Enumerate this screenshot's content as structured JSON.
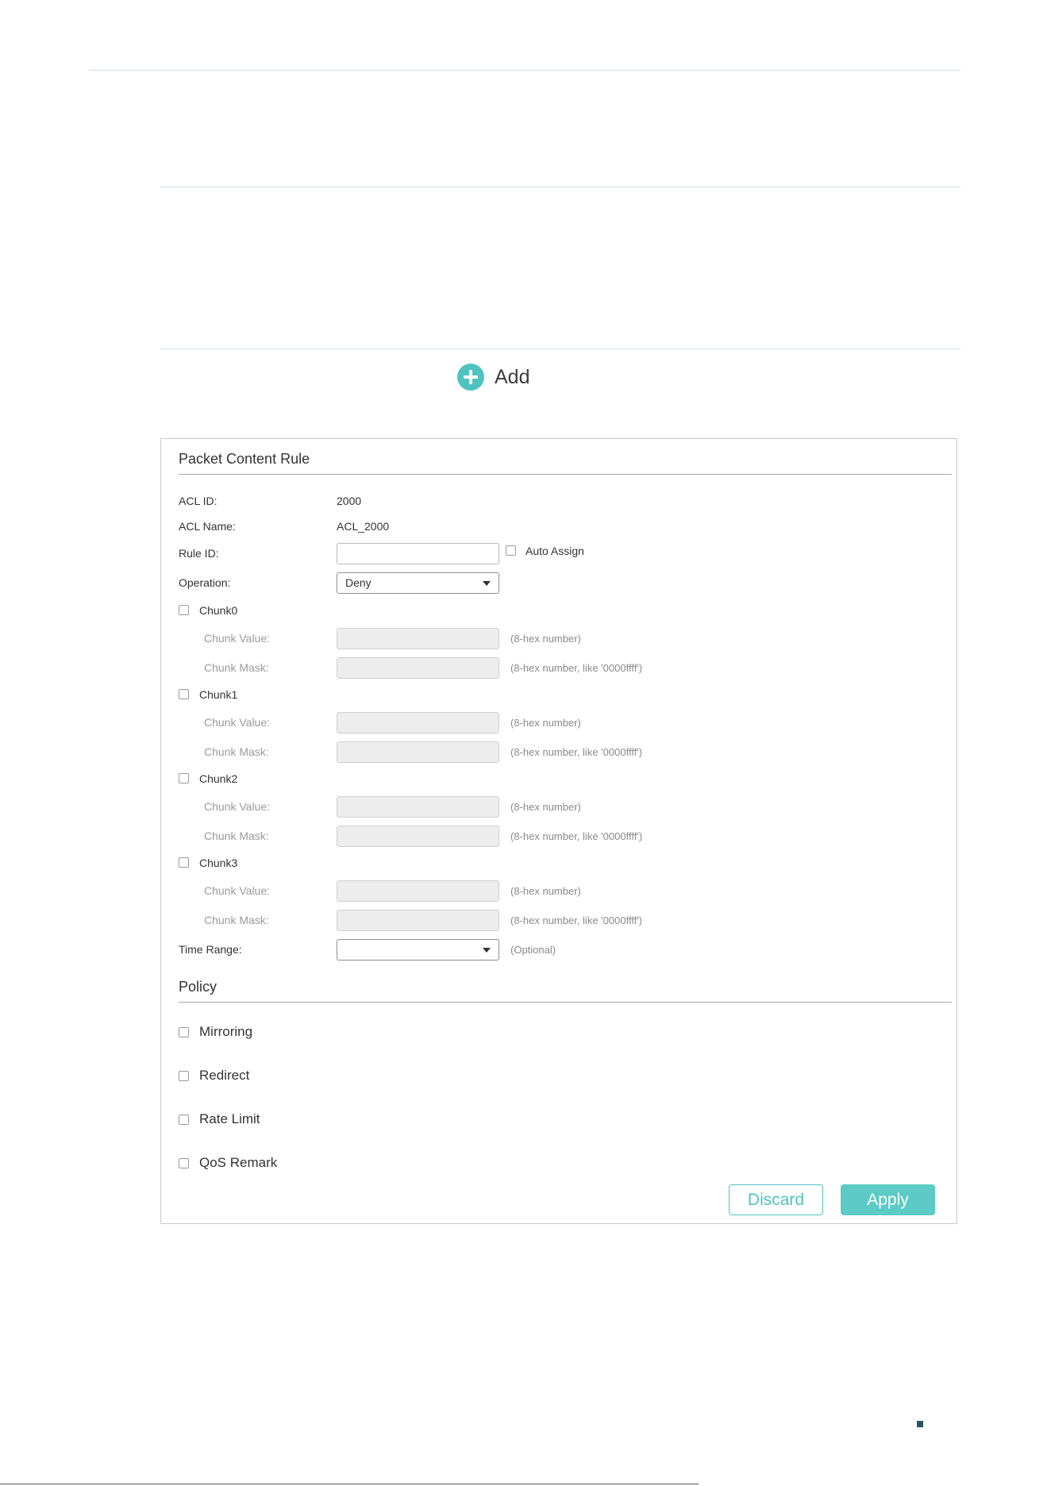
{
  "add": {
    "label": "Add"
  },
  "packet_rule": {
    "title": "Packet Content Rule",
    "acl_id": {
      "label": "ACL ID:",
      "value": "2000"
    },
    "acl_name": {
      "label": "ACL Name:",
      "value": "ACL_2000"
    },
    "rule_id": {
      "label": "Rule ID:",
      "value": "",
      "auto_assign_label": "Auto Assign"
    },
    "operation": {
      "label": "Operation:",
      "value": "Deny"
    },
    "chunks": [
      {
        "label": "Chunk0",
        "value_label": "Chunk Value:",
        "value_hint": "(8-hex number)",
        "mask_label": "Chunk Mask:",
        "mask_hint": "(8-hex number, like '0000ffff')"
      },
      {
        "label": "Chunk1",
        "value_label": "Chunk Value:",
        "value_hint": "(8-hex number)",
        "mask_label": "Chunk Mask:",
        "mask_hint": "(8-hex number, like '0000ffff')"
      },
      {
        "label": "Chunk2",
        "value_label": "Chunk Value:",
        "value_hint": "(8-hex number)",
        "mask_label": "Chunk Mask:",
        "mask_hint": "(8-hex number, like '0000ffff')"
      },
      {
        "label": "Chunk3",
        "value_label": "Chunk Value:",
        "value_hint": "(8-hex number)",
        "mask_label": "Chunk Mask:",
        "mask_hint": "(8-hex number, like '0000ffff')"
      }
    ],
    "time_range": {
      "label": "Time Range:",
      "value": "",
      "hint": "(Optional)"
    }
  },
  "policy": {
    "title": "Policy",
    "items": [
      "Mirroring",
      "Redirect",
      "Rate Limit",
      "QoS Remark"
    ]
  },
  "buttons": {
    "discard": "Discard",
    "apply": "Apply"
  },
  "colors": {
    "accent": "#5ccbc6",
    "add_icon": "#4fc3c0"
  }
}
